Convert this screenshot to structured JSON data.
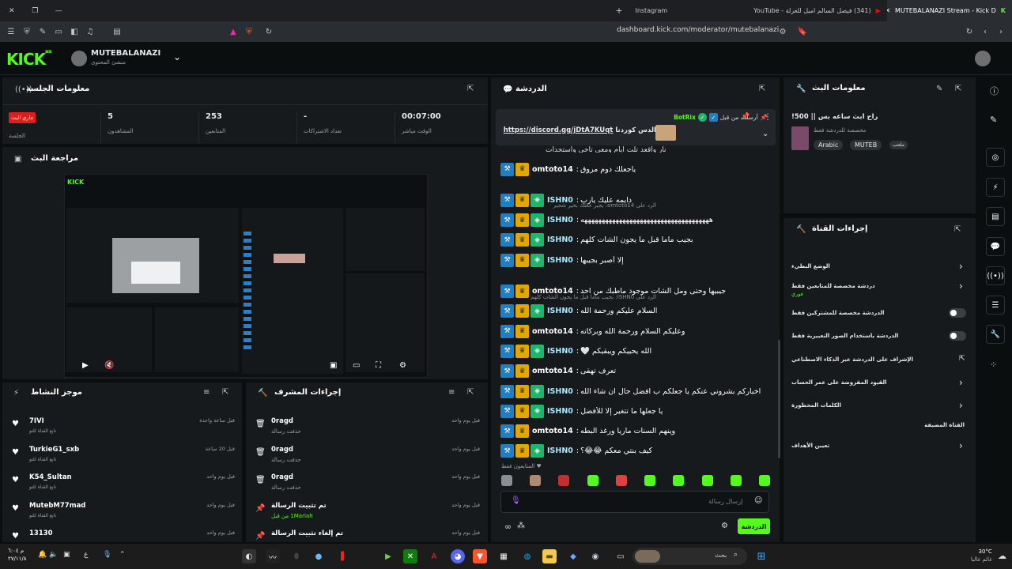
{
  "browser": {
    "tabs": [
      {
        "label": "MUTEBALANAZI Stream - Kick D",
        "active": true
      },
      {
        "label": "(341) فيصل السالم اميل للعزلة - YouTube",
        "active": false
      },
      {
        "label": "Instagram",
        "active": false
      }
    ],
    "url": "dashboard.kick.com/moderator/mutebalanazi"
  },
  "header": {
    "logo": "KICK",
    "logo_beta": "BETA",
    "channel_name": "MUTEBALANAZI",
    "channel_role": "منشئ المحتوى"
  },
  "session": {
    "title": "معلومات الجلسة",
    "live_badge": "جاري البث",
    "stats": [
      {
        "value": "00:07:00",
        "label": "الوقت مباشر"
      },
      {
        "value": "-",
        "label": "تعداد الاشتراكات"
      },
      {
        "value": "253",
        "label": "المتابعين"
      },
      {
        "value": "5",
        "label": "المشاهدون"
      }
    ],
    "session_label": "الجلسة"
  },
  "preview": {
    "title": "مراجعة البث"
  },
  "activity": {
    "title": "موجز النشاط",
    "items": [
      {
        "name": "7IVI",
        "sub": "تابع القناة للتو",
        "time": "قبل ساعة واحدة"
      },
      {
        "name": "TurkieG1_sxb",
        "sub": "تابع القناة للتو",
        "time": "قبل 20 ساعة"
      },
      {
        "name": "K54_Sultan",
        "sub": "تابع القناة للتو",
        "time": "قبل يوم واحد"
      },
      {
        "name": "MutebM77mad",
        "sub": "تابع القناة للتو",
        "time": "قبل يوم واحد"
      },
      {
        "name": "13130",
        "sub": "",
        "time": "قبل يوم واحد"
      }
    ]
  },
  "modactions": {
    "title": "إجراءات المشرف",
    "items": [
      {
        "name": "0ragd",
        "sub": "حذفت رسالة",
        "time": "قبل يوم واحد",
        "icon": "trash"
      },
      {
        "name": "0ragd",
        "sub": "حذفت رسالة",
        "time": "قبل يوم واحد",
        "icon": "trash"
      },
      {
        "name": "0ragd",
        "sub": "حذفت رسالة",
        "time": "قبل يوم واحد",
        "icon": "trash"
      },
      {
        "name": "تم تثبيت الرسالة",
        "sub": "1Mariah من قبل",
        "time": "قبل يوم واحد",
        "icon": "pin"
      },
      {
        "name": "تم إلغاء تثبيت الرسالة",
        "sub": "",
        "time": "قبل يوم واحد",
        "icon": "pin"
      }
    ]
  },
  "chat": {
    "title": "الدردشة",
    "pinned": {
      "by": "أرسلت من قبل",
      "user": "BotRix",
      "text_prefix": "رابط الدس كوردنا",
      "link": "https://discord.gg/jDtA7KUqt"
    },
    "partial_line": "نار واقعد تلت ايام ومعي تاخي واستخدات",
    "messages": [
      {
        "reply": "",
        "user": "omtoto14",
        "text": "ياجعلك دوم مروق",
        "badges": 2,
        "color": "u2"
      },
      {
        "reply": "الرد على omtoto14: يجير جعلك بخير شجير",
        "user": "ISHN0",
        "text": "دايمه عليك يارب",
        "badges": 3,
        "color": "u1"
      },
      {
        "reply": "",
        "user": "ISHN0",
        "text": "هههههههههههههههههههههههههههههههههههههه",
        "badges": 3,
        "color": "u1"
      },
      {
        "reply": "",
        "user": "ISHN0",
        "text": "بجيب ماما قبل ما يجون الشات كلهم",
        "badges": 3,
        "color": "u1"
      },
      {
        "reply": "",
        "user": "ISHN0",
        "text": "إلا أصبر بجيبها",
        "badges": 3,
        "color": "u1"
      },
      {
        "reply": "الرد على ISHN0: بجيب ماما قبل ما يجون الشات كلهم",
        "user": "omtoto14",
        "text": "جيبيها وحتى ومل الشات موجود ماطبك من احد",
        "badges": 2,
        "color": "u2"
      },
      {
        "reply": "",
        "user": "ISHN0",
        "text": "السلام عليكم ورحمة الله",
        "badges": 3,
        "color": "u1"
      },
      {
        "reply": "",
        "user": "omtoto14",
        "text": "وعليكم السلام ورحمة الله وبركاته",
        "badges": 2,
        "color": "u2"
      },
      {
        "reply": "",
        "user": "ISHN0",
        "text": "الله يحييكم ويبقيكم 🤍",
        "badges": 3,
        "color": "u1"
      },
      {
        "reply": "",
        "user": "omtoto14",
        "text": "تعرف تهقى",
        "badges": 2,
        "color": "u2"
      },
      {
        "reply": "",
        "user": "ISHN0",
        "text": "اخباركم بشروني عنكم يا جعلكم ب افضل حال ان شاء الله",
        "badges": 3,
        "color": "u1"
      },
      {
        "reply": "",
        "user": "ISHN0",
        "text": "يا جعلها ما تتغير إلا للأفضل",
        "badges": 3,
        "color": "u1"
      },
      {
        "reply": "",
        "user": "omtoto14",
        "text": "وينهم السنات ماريا ورغد البطه",
        "badges": 2,
        "color": "u2"
      },
      {
        "reply": "",
        "user": "ISHN0",
        "text": "كيف بنتي معكم 😂😂؟",
        "badges": 3,
        "color": "u1"
      }
    ],
    "followers_only": "المتابعون فقط",
    "input_placeholder": "إرسال رسالة",
    "send_label": "الدردشة"
  },
  "streaminfo": {
    "title": "معلومات البث",
    "stream_title": "راح ابث ساعه بس || 500!",
    "category": "مخصصة للدردشة فقط",
    "tags": [
      "Arabic",
      "MUTEB"
    ],
    "tag_extra": "ملحب"
  },
  "channelactions": {
    "title": "إجراءات القناة",
    "items": [
      {
        "label": "الوضع البطيء",
        "sub": "",
        "control": "chevron"
      },
      {
        "label": "دردشة مخصصة للمتابعين فقط",
        "sub": "فوري",
        "control": "chevron"
      },
      {
        "label": "الدردشة مخصصة للمشتركين فقط",
        "sub": "",
        "control": "toggle"
      },
      {
        "label": "الدردشة باستخدام الصور التعبيرية فقط",
        "sub": "",
        "control": "toggle"
      },
      {
        "label": "الإشراف على الدردشة عبر الذكاء الاصطناعي",
        "sub": "",
        "control": "external"
      },
      {
        "label": "القيود المفروضة على عمر الحساب",
        "sub": "",
        "control": "chevron"
      },
      {
        "label": "الكلمات المحظورة",
        "sub": "",
        "control": "chevron"
      },
      {
        "label": "القناة المضيفة",
        "sub": "",
        "control": "none"
      },
      {
        "label": "تعيين الأهداف",
        "sub": "",
        "control": "chevron"
      }
    ]
  },
  "taskbar": {
    "search": "بحث",
    "weather_temp": "30°C",
    "weather_desc": "غائم غالبا",
    "time": "م ٦:٠٤",
    "date": "٢٧/١١/٨"
  }
}
